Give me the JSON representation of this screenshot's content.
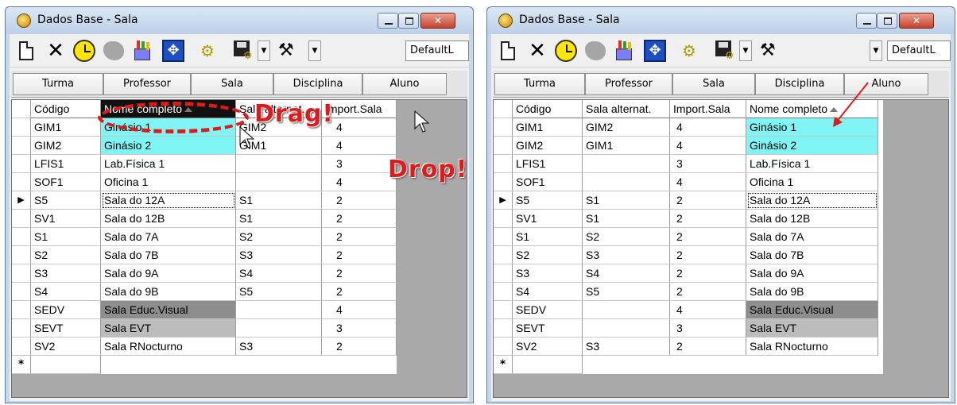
{
  "windows": [
    {
      "title": "Dados Base - Sala",
      "toolbar": {
        "default_combo": "DefaultL"
      },
      "tabs": [
        "Turma",
        "Professor",
        "Sala",
        "Disciplina",
        "Aluno"
      ],
      "columns": [
        "Código",
        "Nome completo",
        "Sala alternat.",
        "Import.Sala"
      ],
      "rows": [
        [
          "GIM1",
          "Ginásio 1",
          "GIM2",
          "4"
        ],
        [
          "GIM2",
          "Ginásio 2",
          "GIM1",
          "4"
        ],
        [
          "LFIS1",
          "Lab.Física 1",
          "",
          "3"
        ],
        [
          "SOF1",
          "Oficina 1",
          "",
          "4"
        ],
        [
          "S5",
          "Sala do 12A",
          "S1",
          "2"
        ],
        [
          "SV1",
          "Sala do 12B",
          "S1",
          "2"
        ],
        [
          "S1",
          "Sala do 7A",
          "S2",
          "2"
        ],
        [
          "S2",
          "Sala do 7B",
          "S3",
          "2"
        ],
        [
          "S3",
          "Sala do 9A",
          "S4",
          "2"
        ],
        [
          "S4",
          "Sala do 9B",
          "S5",
          "2"
        ],
        [
          "SEDV",
          "Sala Educ.Visual",
          "",
          "4"
        ],
        [
          "SEVT",
          "Sala EVT",
          "",
          "3"
        ],
        [
          "SV2",
          "Sala RNocturno",
          "S3",
          "2"
        ]
      ],
      "current_row_marker": "▶",
      "new_row_marker": "*"
    },
    {
      "title": "Dados Base - Sala",
      "toolbar": {
        "default_combo": "DefaultL"
      },
      "tabs": [
        "Turma",
        "Professor",
        "Sala",
        "Disciplina",
        "Aluno"
      ],
      "columns": [
        "Código",
        "Sala alternat.",
        "Import.Sala",
        "Nome completo"
      ],
      "rows": [
        [
          "GIM1",
          "GIM2",
          "4",
          "Ginásio 1"
        ],
        [
          "GIM2",
          "GIM1",
          "4",
          "Ginásio 2"
        ],
        [
          "LFIS1",
          "",
          "3",
          "Lab.Física 1"
        ],
        [
          "SOF1",
          "",
          "4",
          "Oficina 1"
        ],
        [
          "S5",
          "S1",
          "2",
          "Sala do 12A"
        ],
        [
          "SV1",
          "S1",
          "2",
          "Sala do 12B"
        ],
        [
          "S1",
          "S2",
          "2",
          "Sala do 7A"
        ],
        [
          "S2",
          "S3",
          "2",
          "Sala do 7B"
        ],
        [
          "S3",
          "S4",
          "2",
          "Sala do 9A"
        ],
        [
          "S4",
          "S5",
          "2",
          "Sala do 9B"
        ],
        [
          "SEDV",
          "",
          "4",
          "Sala Educ.Visual"
        ],
        [
          "SEVT",
          "",
          "3",
          "Sala EVT"
        ],
        [
          "SV2",
          "S3",
          "2",
          "Sala RNocturno"
        ]
      ],
      "current_row_marker": "▶",
      "new_row_marker": "*"
    }
  ],
  "annotations": {
    "drag": "Drag!",
    "drop": "Drop!"
  },
  "colors": {
    "highlight_cyan": "#7ff5f5",
    "highlight_dark": "#8d8d8d",
    "highlight_mid": "#bcbcbc",
    "annotation_red": "#e01a1a"
  }
}
